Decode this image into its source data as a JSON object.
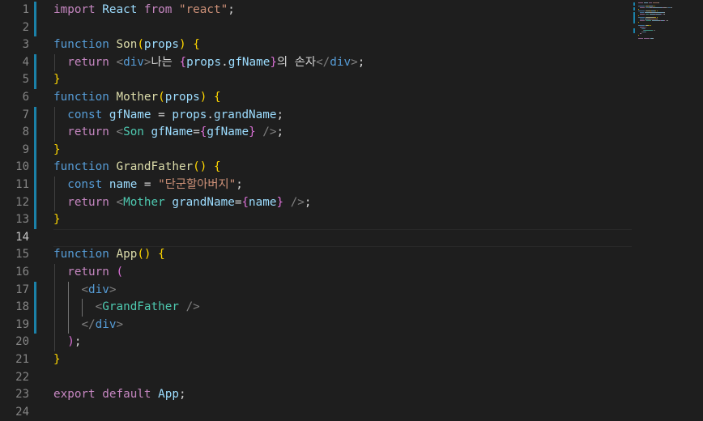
{
  "editor": {
    "line_numbers": [
      "1",
      "2",
      "3",
      "4",
      "5",
      "6",
      "7",
      "8",
      "9",
      "10",
      "11",
      "12",
      "13",
      "14",
      "15",
      "16",
      "17",
      "18",
      "19",
      "20",
      "21",
      "22",
      "23",
      "24"
    ],
    "active_line": "14",
    "lines": [
      [
        [
          "kw",
          "import"
        ],
        [
          "txt",
          " "
        ],
        [
          "var",
          "React"
        ],
        [
          "txt",
          " "
        ],
        [
          "kw",
          "from"
        ],
        [
          "txt",
          " "
        ],
        [
          "str",
          "\"react\""
        ],
        [
          "txt",
          ";"
        ]
      ],
      [],
      [
        [
          "st",
          "function"
        ],
        [
          "txt",
          " "
        ],
        [
          "fn",
          "Son"
        ],
        [
          "br1",
          "("
        ],
        [
          "var",
          "props"
        ],
        [
          "br1",
          ")"
        ],
        [
          "txt",
          " "
        ],
        [
          "br1",
          "{"
        ]
      ],
      [
        [
          "txt",
          "  "
        ],
        [
          "kw",
          "return"
        ],
        [
          "txt",
          " "
        ],
        [
          "pun",
          "<"
        ],
        [
          "st",
          "div"
        ],
        [
          "pun",
          ">"
        ],
        [
          "txt",
          "나는 "
        ],
        [
          "br2",
          "{"
        ],
        [
          "var",
          "props"
        ],
        [
          "txt",
          "."
        ],
        [
          "var",
          "gfName"
        ],
        [
          "br2",
          "}"
        ],
        [
          "txt",
          "의 손자"
        ],
        [
          "pun",
          "</"
        ],
        [
          "st",
          "div"
        ],
        [
          "pun",
          ">"
        ],
        [
          "txt",
          ";"
        ]
      ],
      [
        [
          "br1",
          "}"
        ]
      ],
      [
        [
          "st",
          "function"
        ],
        [
          "txt",
          " "
        ],
        [
          "fn",
          "Mother"
        ],
        [
          "br1",
          "("
        ],
        [
          "var",
          "props"
        ],
        [
          "br1",
          ")"
        ],
        [
          "txt",
          " "
        ],
        [
          "br1",
          "{"
        ]
      ],
      [
        [
          "txt",
          "  "
        ],
        [
          "st",
          "const"
        ],
        [
          "txt",
          " "
        ],
        [
          "var",
          "gfName"
        ],
        [
          "txt",
          " = "
        ],
        [
          "var",
          "props"
        ],
        [
          "txt",
          "."
        ],
        [
          "var",
          "grandName"
        ],
        [
          "txt",
          ";"
        ]
      ],
      [
        [
          "txt",
          "  "
        ],
        [
          "kw",
          "return"
        ],
        [
          "txt",
          " "
        ],
        [
          "pun",
          "<"
        ],
        [
          "tag",
          "Son"
        ],
        [
          "txt",
          " "
        ],
        [
          "var",
          "gfName"
        ],
        [
          "txt",
          "="
        ],
        [
          "br2",
          "{"
        ],
        [
          "var",
          "gfName"
        ],
        [
          "br2",
          "}"
        ],
        [
          "txt",
          " "
        ],
        [
          "pun",
          "/>"
        ],
        [
          "txt",
          ";"
        ]
      ],
      [
        [
          "br1",
          "}"
        ]
      ],
      [
        [
          "st",
          "function"
        ],
        [
          "txt",
          " "
        ],
        [
          "fn",
          "GrandFather"
        ],
        [
          "br1",
          "()"
        ],
        [
          "txt",
          " "
        ],
        [
          "br1",
          "{"
        ]
      ],
      [
        [
          "txt",
          "  "
        ],
        [
          "st",
          "const"
        ],
        [
          "txt",
          " "
        ],
        [
          "var",
          "name"
        ],
        [
          "txt",
          " = "
        ],
        [
          "str",
          "\"단군할아버지\""
        ],
        [
          "txt",
          ";"
        ]
      ],
      [
        [
          "txt",
          "  "
        ],
        [
          "kw",
          "return"
        ],
        [
          "txt",
          " "
        ],
        [
          "pun",
          "<"
        ],
        [
          "tag",
          "Mother"
        ],
        [
          "txt",
          " "
        ],
        [
          "var",
          "grandName"
        ],
        [
          "txt",
          "="
        ],
        [
          "br2",
          "{"
        ],
        [
          "var",
          "name"
        ],
        [
          "br2",
          "}"
        ],
        [
          "txt",
          " "
        ],
        [
          "pun",
          "/>"
        ],
        [
          "txt",
          ";"
        ]
      ],
      [
        [
          "br1",
          "}"
        ]
      ],
      [],
      [
        [
          "st",
          "function"
        ],
        [
          "txt",
          " "
        ],
        [
          "fn",
          "App"
        ],
        [
          "br1",
          "()"
        ],
        [
          "txt",
          " "
        ],
        [
          "br1",
          "{"
        ]
      ],
      [
        [
          "txt",
          "  "
        ],
        [
          "kw",
          "return"
        ],
        [
          "txt",
          " "
        ],
        [
          "br2",
          "("
        ]
      ],
      [
        [
          "txt",
          "    "
        ],
        [
          "pun",
          "<"
        ],
        [
          "st",
          "div"
        ],
        [
          "pun",
          ">"
        ]
      ],
      [
        [
          "txt",
          "      "
        ],
        [
          "pun",
          "<"
        ],
        [
          "tag",
          "GrandFather"
        ],
        [
          "txt",
          " "
        ],
        [
          "pun",
          "/>"
        ]
      ],
      [
        [
          "txt",
          "    "
        ],
        [
          "pun",
          "</"
        ],
        [
          "st",
          "div"
        ],
        [
          "pun",
          ">"
        ]
      ],
      [
        [
          "txt",
          "  "
        ],
        [
          "br2",
          ")"
        ],
        [
          "txt",
          ";"
        ]
      ],
      [
        [
          "br1",
          "}"
        ]
      ],
      [],
      [
        [
          "kw",
          "export"
        ],
        [
          "txt",
          " "
        ],
        [
          "kw",
          "default"
        ],
        [
          "txt",
          " "
        ],
        [
          "var",
          "App"
        ],
        [
          "txt",
          ";"
        ]
      ],
      []
    ]
  },
  "colors": {
    "background": "#1e1e1e",
    "line_number": "#858585",
    "git_modified": "#1b81a8"
  }
}
